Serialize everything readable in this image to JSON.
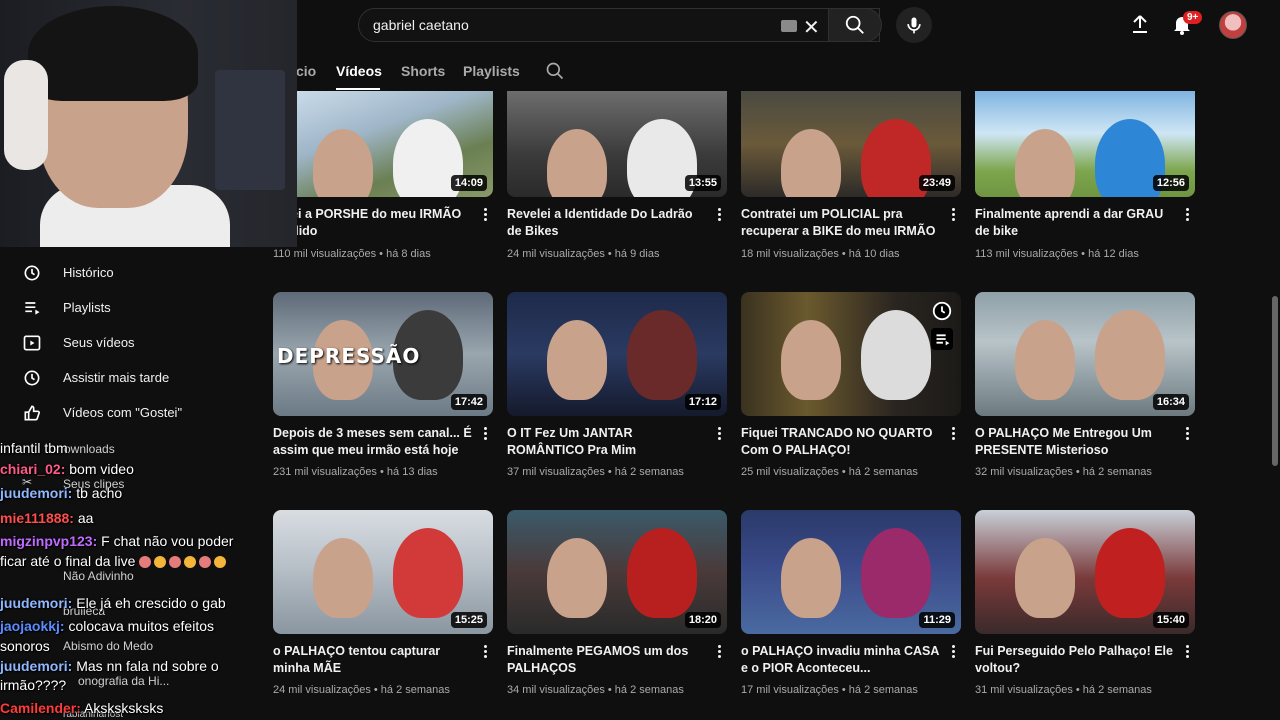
{
  "search": {
    "query": "gabriel caetano"
  },
  "header": {
    "notifications_badge": "9+"
  },
  "tabs": [
    {
      "label": "Início",
      "visible": "cio"
    },
    {
      "label": "Vídeos"
    },
    {
      "label": "Shorts"
    },
    {
      "label": "Playlists"
    }
  ],
  "sidebar": {
    "items": [
      {
        "label": "Histórico",
        "icon": "history-icon"
      },
      {
        "label": "Playlists",
        "icon": "playlist-icon"
      },
      {
        "label": "Seus vídeos",
        "icon": "your-videos-icon"
      },
      {
        "label": "Assistir mais tarde",
        "icon": "watch-later-icon"
      },
      {
        "label": "Vídeos com \"Gostei\"",
        "icon": "like-icon"
      }
    ],
    "ghost": [
      "ownloads",
      "Seus clipes",
      "Não Adivinho",
      "brulleca",
      "Abismo do Medo",
      "onografia da Hi...",
      "rabianinanost"
    ]
  },
  "chat": [
    {
      "user": "",
      "msg": "infantil tbm",
      "color": "#ffffff"
    },
    {
      "user": "chiari_02:",
      "msg": "bom video",
      "color": "#ff5a8a"
    },
    {
      "user": "juudemori:",
      "msg": "tb acho",
      "color": "#8fb7ff"
    },
    {
      "user": "mie111888:",
      "msg": "aa",
      "color": "#ff4d4d"
    },
    {
      "user": "migzinpvp123:",
      "msg": "F chat não vou poder",
      "color": "#c06bff"
    },
    {
      "user": "",
      "msg": "ficar até o final da live",
      "color": "#ffffff"
    },
    {
      "user": "juudemori:",
      "msg": "Ele já eh crescido o gab",
      "color": "#8fb7ff"
    },
    {
      "user": "jaojaokkj:",
      "msg": "colocava muitos efeitos",
      "color": "#5a8cff"
    },
    {
      "user": "",
      "msg": "sonoros",
      "color": "#ffffff"
    },
    {
      "user": "juudemori:",
      "msg": "Mas nn fala nd sobre o",
      "color": "#8fb7ff"
    },
    {
      "user": "",
      "msg": "irmão????",
      "color": "#ffffff"
    },
    {
      "user": "Camilender:",
      "msg": "Aksksksksks",
      "color": "#ff3b3b"
    }
  ],
  "videos": [
    {
      "title": "...uei a PORSHE do meu IRMÃO ...ndido",
      "views": "110 mil visualizações",
      "age": "há 8 dias",
      "duration": "14:09"
    },
    {
      "title": "Revelei a Identidade Do Ladrão de Bikes",
      "views": "24 mil visualizações",
      "age": "há 9 dias",
      "duration": "13:55"
    },
    {
      "title": "Contratei um POLICIAL pra recuperar a BIKE do meu IRMÃO",
      "views": "18 mil visualizações",
      "age": "há 10 dias",
      "duration": "23:49"
    },
    {
      "title": "Finalmente aprendi a dar GRAU de bike",
      "views": "113 mil visualizações",
      "age": "há 12 dias",
      "duration": "12:56"
    },
    {
      "title": "Depois de 3 meses sem canal... É assim que meu irmão está hoje",
      "views": "231 mil visualizações",
      "age": "há 13 dias",
      "duration": "17:42",
      "thumb_text": "DEPRESSÃO"
    },
    {
      "title": "O IT Fez Um JANTAR ROMÂNTICO Pra Mim",
      "views": "37 mil visualizações",
      "age": "há 2 semanas",
      "duration": "17:12"
    },
    {
      "title": "Fiquei TRANCADO NO QUARTO Com O PALHAÇO!",
      "views": "25 mil visualizações",
      "age": "há 2 semanas",
      "duration": ""
    },
    {
      "title": "O PALHAÇO Me Entregou Um PRESENTE Misterioso",
      "views": "32 mil visualizações",
      "age": "há 2 semanas",
      "duration": "16:34"
    },
    {
      "title": "o PALHAÇO tentou capturar minha MÃE",
      "views": "24 mil visualizações",
      "age": "há 2 semanas",
      "duration": "15:25"
    },
    {
      "title": "Finalmente PEGAMOS um dos PALHAÇOS",
      "views": "34 mil visualizações",
      "age": "há 2 semanas",
      "duration": "18:20"
    },
    {
      "title": "o PALHAÇO invadiu minha CASA e o PIOR Aconteceu...",
      "views": "17 mil visualizações",
      "age": "há 2 semanas",
      "duration": "11:29"
    },
    {
      "title": "Fui Perseguido Pelo Palhaço! Ele voltou?",
      "views": "31 mil visualizações",
      "age": "há 2 semanas",
      "duration": "15:40"
    }
  ]
}
